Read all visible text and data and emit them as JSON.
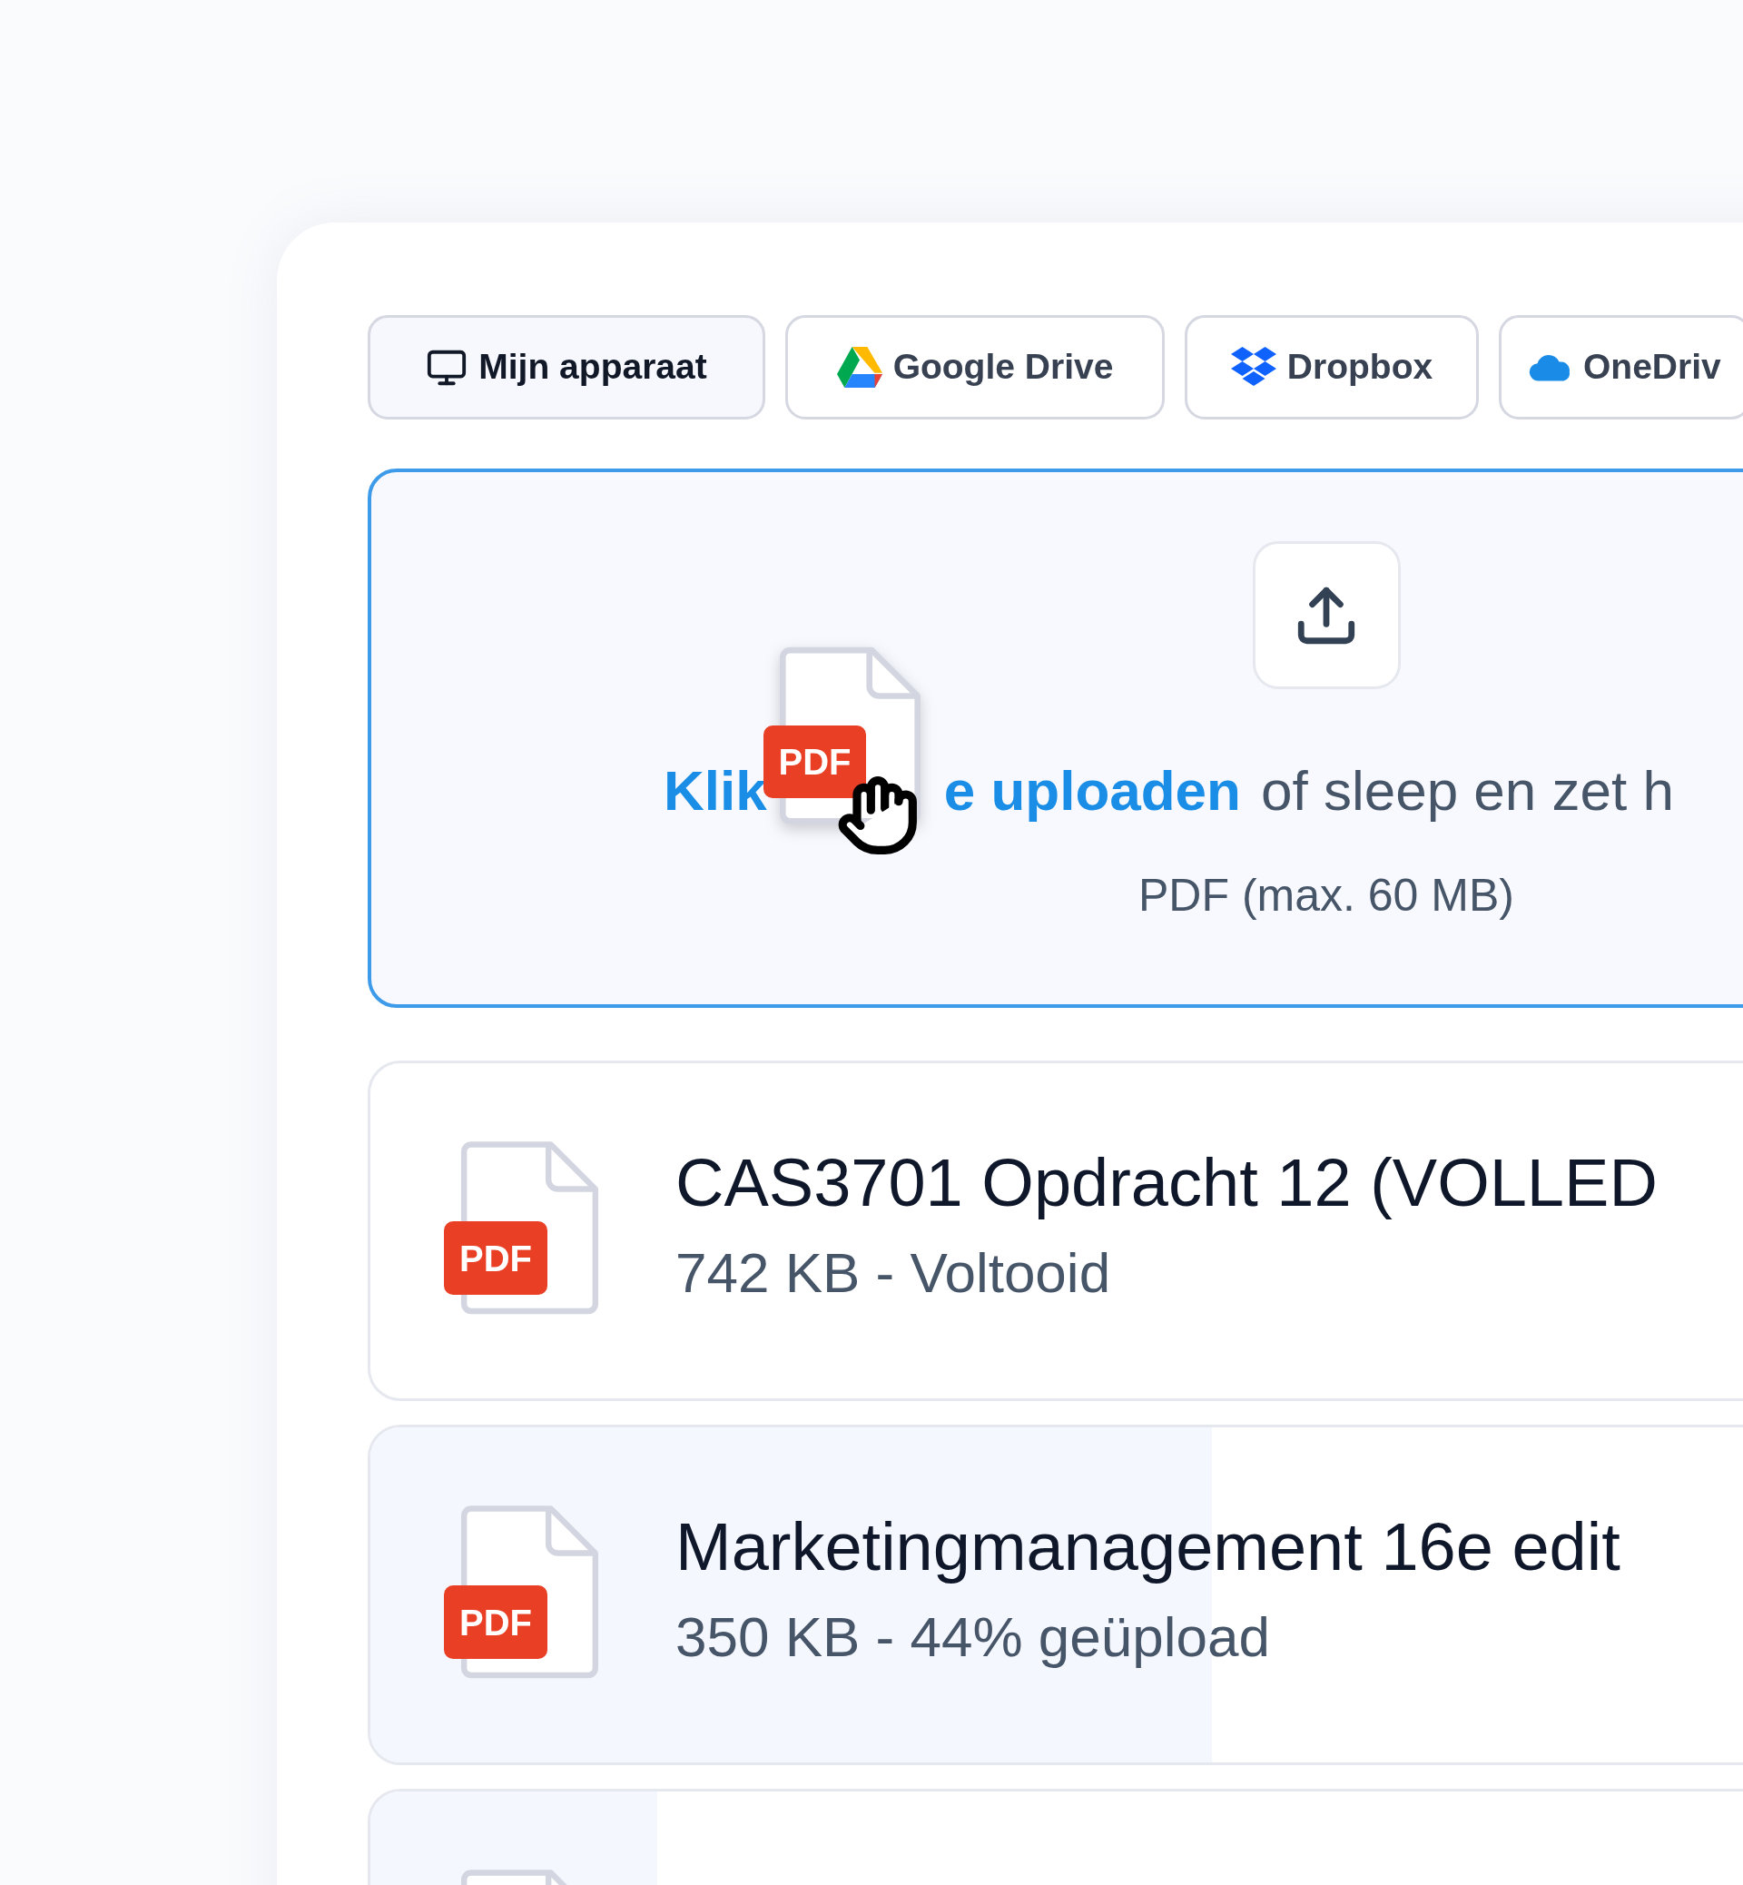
{
  "sources": [
    {
      "label": "Mijn apparaat",
      "kind": "device",
      "selected": true
    },
    {
      "label": "Google Drive",
      "kind": "gdrive",
      "selected": false
    },
    {
      "label": "Dropbox",
      "kind": "dropbox",
      "selected": false
    },
    {
      "label": "OneDriv",
      "kind": "onedrive",
      "selected": false
    }
  ],
  "dropzone": {
    "active": true,
    "drag_file_tag": "PDF",
    "link_parts": [
      "Klik",
      "e uploaden"
    ],
    "text": "of sleep en zet h",
    "hint": "PDF (max. 60 MB)"
  },
  "files": [
    {
      "tag": "PDF",
      "name": "CAS3701 Opdracht 12 (VOLLED",
      "info": "742 KB - Voltooid"
    },
    {
      "tag": "PDF",
      "name": "Marketingmanagement 16e edit",
      "info": "350 KB - 44% geüpload",
      "level": 0.44
    },
    {
      "level": 0.15
    }
  ]
}
